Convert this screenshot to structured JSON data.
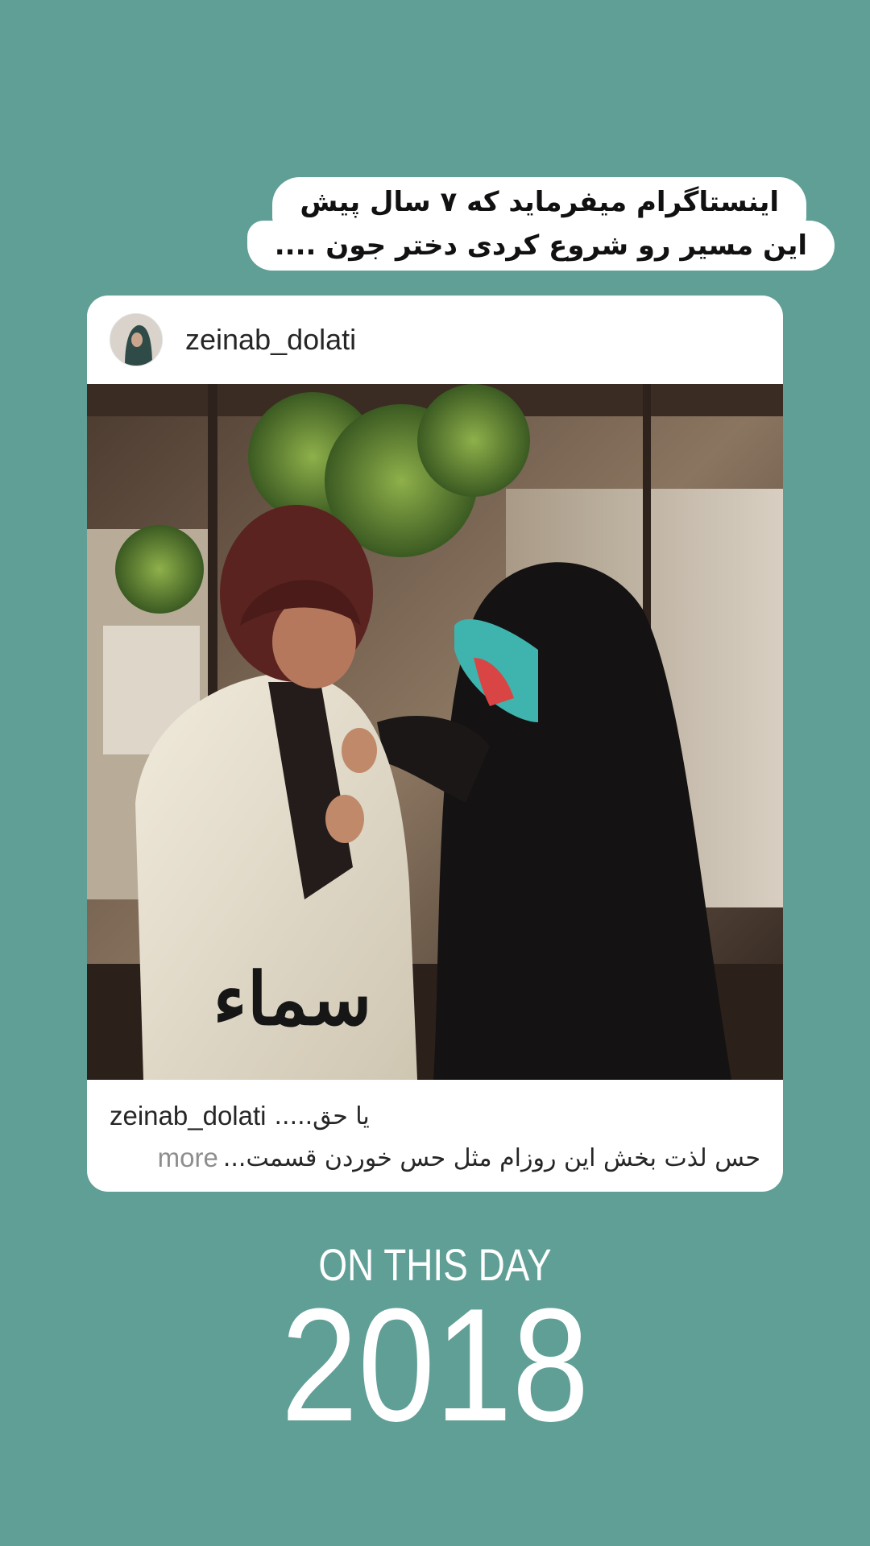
{
  "story": {
    "bubble_lines": [
      "اینستاگرام میفرماید که ۷ سال پیش",
      "این مسیر رو شروع کردی دختر جون ...."
    ],
    "background_color": "#5f9f95"
  },
  "post": {
    "username": "zeinab_dolati",
    "avatar_icon": "avatar-photo",
    "image_description_icon": "post-photo",
    "watermark_text": "سماء",
    "caption": {
      "username": "zeinab_dolati",
      "first_line": "یا حق.....",
      "second_line": "حس لذت بخش این روزام مثل حس خوردن قسمت...",
      "more_label": "more"
    }
  },
  "on_this_day": {
    "title": "ON THIS DAY",
    "year": "2018"
  }
}
